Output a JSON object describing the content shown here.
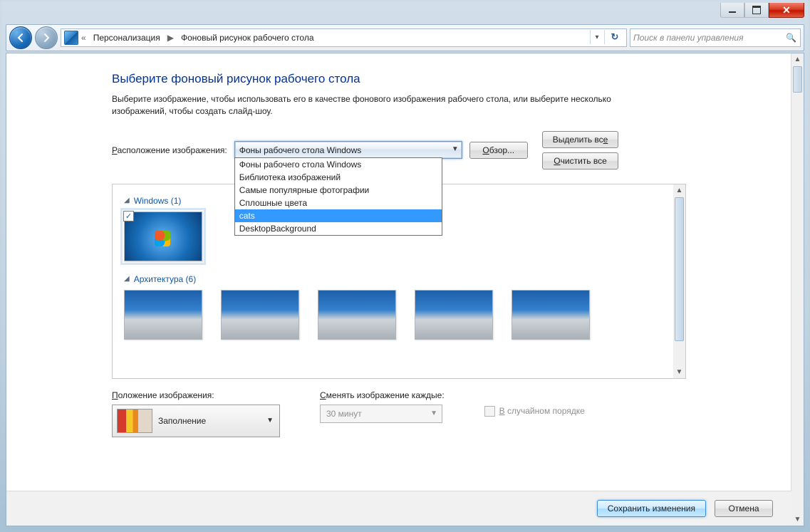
{
  "window": {
    "breadcrumb_root": "Персонализация",
    "breadcrumb_current": "Фоновый рисунок рабочего стола",
    "search_placeholder": "Поиск в панели управления"
  },
  "page": {
    "heading": "Выберите фоновый рисунок рабочего стола",
    "description": "Выберите изображение, чтобы использовать его в качестве фонового изображения рабочего стола, или выберите несколько изображений, чтобы создать слайд-шоу."
  },
  "location": {
    "label_pre": "Р",
    "label": "асположение изображения:",
    "selected": "Фоны рабочего стола Windows",
    "options": [
      "Фоны рабочего стола Windows",
      "Библиотека изображений",
      "Самые популярные фотографии",
      "Сплошные цвета",
      "cats",
      "DesktopBackground"
    ],
    "highlighted_index": 4,
    "browse_pre": "О",
    "browse": "бзор...",
    "select_all": "Выделить вс",
    "select_all_u": "е",
    "clear_all_pre": "О",
    "clear_all": "чистить все"
  },
  "gallery": {
    "groups": [
      {
        "name": "Windows",
        "count": 1
      },
      {
        "name": "Архитектура",
        "count": 6
      }
    ]
  },
  "position": {
    "label_pre": "П",
    "label": "оложение изображения:",
    "value": "Заполнение"
  },
  "interval": {
    "label_pre": "С",
    "label": "менять изображение каждые:",
    "value": "30 минут"
  },
  "shuffle": {
    "label_pre": "В",
    "label": " случайном порядке"
  },
  "footer": {
    "save": "Сохранить изменения",
    "cancel": "Отмена"
  }
}
